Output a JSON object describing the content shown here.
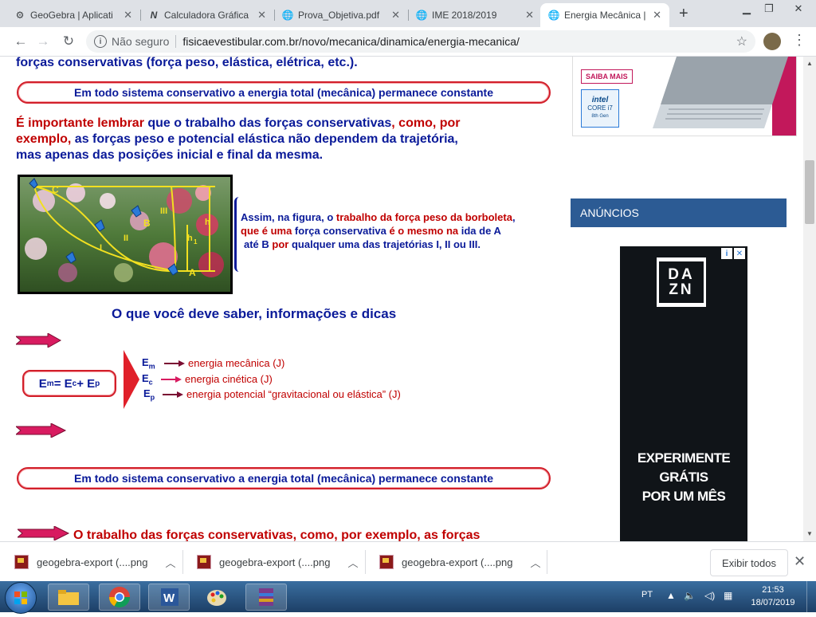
{
  "browser": {
    "tabs": [
      {
        "label": "GeoGebra | Aplicati",
        "icon": "gear-icon"
      },
      {
        "label": "Calculadora Gráfica",
        "icon": "geogebra-n-icon"
      },
      {
        "label": "Prova_Objetiva.pdf",
        "icon": "globe-icon"
      },
      {
        "label": "IME 2018/2019",
        "icon": "globe-icon"
      },
      {
        "label": "Energia Mecânica |",
        "icon": "globe-icon",
        "active": true
      }
    ],
    "new_tab": "+",
    "security_label": "Não seguro",
    "url": "fisicaevestibular.com.br/novo/mecanica/dinamica/energia-mecanica/"
  },
  "content": {
    "intro_line": "forças conservativas (força peso, elástica, elétrica, etc.).",
    "pill_text": "Em todo sistema conservativo a energia total (mecânica) permanece constante",
    "important": {
      "line1_a": "É importante lembrar ",
      "line1_b": "que o",
      "line1_c": " trabalho das forças conservativas",
      "line1_d": ", como, por",
      "line2_a": "exemplo,",
      "line2_b": " as forças peso e potencial elástica não dependem da trajetória,",
      "line3": "mas apenas das posições inicial e final da mesma."
    },
    "figure_labels": {
      "c": "C",
      "b": "B",
      "a": "A",
      "i": "I",
      "ii": "II",
      "iii": "III",
      "h1": "h",
      "h1_sub": "1",
      "h": "h"
    },
    "figure_caption": {
      "l1_a": "Assim, na figura, o ",
      "l1_b": "trabalho da força peso da borboleta",
      "l1_c": ",",
      "l2_a": "que é uma ",
      "l2_b": "força conservativa",
      "l2_c": " é o mesmo na ",
      "l2_d": "ida de A",
      "l3_a": "até B",
      "l3_b": "por",
      "l3_c": " qualquer uma das trajetórias I, II ou III",
      "l3_d": "."
    },
    "section_heading": "O que você deve saber, informações e dicas",
    "formula": {
      "em": "E",
      "em_sub": "m",
      "eq": " = E",
      "ec_sub": "c",
      "plus": " + E",
      "ep_sub": "p"
    },
    "legend": [
      {
        "sym": "E",
        "sub": "m",
        "text": "energia mecânica (J)"
      },
      {
        "sym": "E",
        "sub": "c",
        "text": "energia cinética (J)"
      },
      {
        "sym": "E",
        "sub": "p",
        "text": "energia potencial “gravitacional ou elástica” (J)"
      }
    ],
    "pill_text_2": "Em todo sistema conservativo a energia total (mecânica) permanece constante",
    "bottom_line_a": "O trabalho das forças conservativas",
    "bottom_line_b": ", como, por exemplo, as forças"
  },
  "sidebar": {
    "ad_button": "SAIBA MAIS",
    "intel_line1": "intel",
    "intel_line2": "CORE i7",
    "intel_line3": "8th Gen",
    "announcements": "ANÚNCIOS",
    "dazn_logo_1": "DA",
    "dazn_logo_2": "ZN",
    "dazn_promo_1": "EXPERIMENTE GRÁTIS",
    "dazn_promo_2": "POR UM MÊS"
  },
  "downloads": {
    "items": [
      "geogebra-export (....png",
      "geogebra-export (....png",
      "geogebra-export (....png"
    ],
    "show_all": "Exibir todos"
  },
  "taskbar": {
    "language": "PT",
    "time": "21:53",
    "date": "18/07/2019"
  }
}
